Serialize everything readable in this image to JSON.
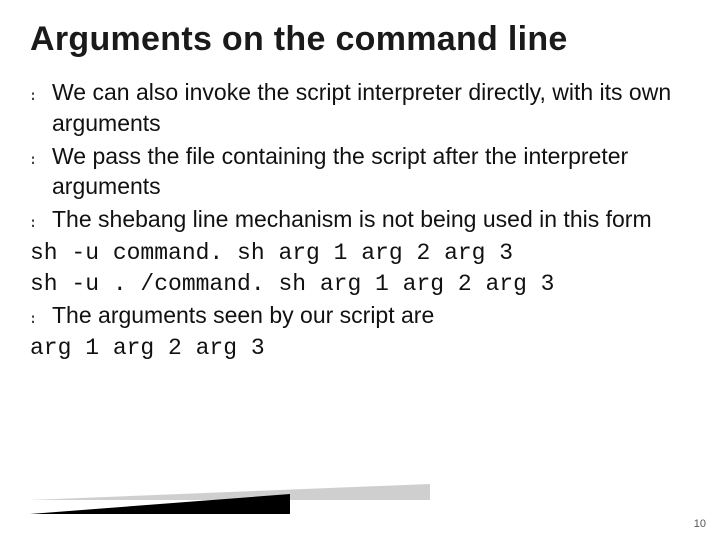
{
  "title": "Arguments on the command line",
  "bullets": [
    "We can also invoke the script interpreter directly, with its own arguments",
    "We pass the file containing the script after the interpreter arguments",
    "The shebang line mechanism is not being used in this form"
  ],
  "code_lines": [
    "sh -u command. sh arg 1 arg 2 arg 3",
    "sh -u . /command. sh arg 1 arg 2 arg 3"
  ],
  "bullets_after": [
    "The arguments seen by our script are"
  ],
  "code_lines_after": [
    "arg 1 arg 2 arg 3"
  ],
  "bullet_marker": "։",
  "page_number": "10"
}
